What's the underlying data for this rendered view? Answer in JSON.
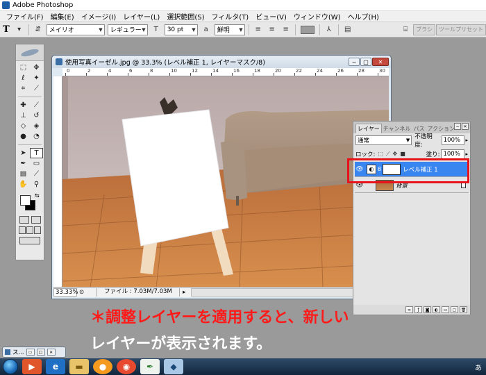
{
  "app": {
    "title": "Adobe Photoshop"
  },
  "menu": [
    "ファイル(F)",
    "編集(E)",
    "イメージ(I)",
    "レイヤー(L)",
    "選択範囲(S)",
    "フィルタ(T)",
    "ビュー(V)",
    "ウィンドウ(W)",
    "ヘルプ(H)"
  ],
  "options": {
    "tool_glyph": "T",
    "font_family": "メイリオ",
    "font_style": "レギュラー",
    "font_size": "30 pt",
    "antialias": "鮮明",
    "tabs": [
      "ブラシ",
      "ツールプリセット"
    ]
  },
  "document": {
    "title": "使用写真イーゼル.jpg @ 33.3% (レベル補正 1, レイヤーマスク/8)",
    "zoom": "33.33%",
    "file_info": "ファイル : 7.03M/7.03M",
    "ruler_labels": [
      "0",
      "2",
      "4",
      "6",
      "8",
      "10",
      "12",
      "14",
      "16",
      "18",
      "20",
      "22",
      "24",
      "26",
      "28",
      "30"
    ]
  },
  "layers_panel": {
    "tabs": [
      "レイヤー",
      "チャンネル",
      "パス",
      "アクション"
    ],
    "blend_mode": "通常",
    "opacity_label": "不透明度:",
    "opacity": "100%",
    "lock_label": "ロック:",
    "fill_label": "塗り:",
    "fill": "100%",
    "layers": [
      {
        "name": "レベル補正 1",
        "active": true
      },
      {
        "name": "背景",
        "active": false
      }
    ]
  },
  "caption": {
    "line1": "＊調整レイヤーを適用すると、新しい",
    "line2": "レイヤーが表示されます。"
  },
  "minimized_window": {
    "label": "ス..."
  },
  "taskbar": {
    "tray_text": "あ"
  },
  "colors": {
    "highlight": "#e8121a",
    "active_layer": "#3a86f0",
    "caption_red": "#ff1a1a"
  }
}
